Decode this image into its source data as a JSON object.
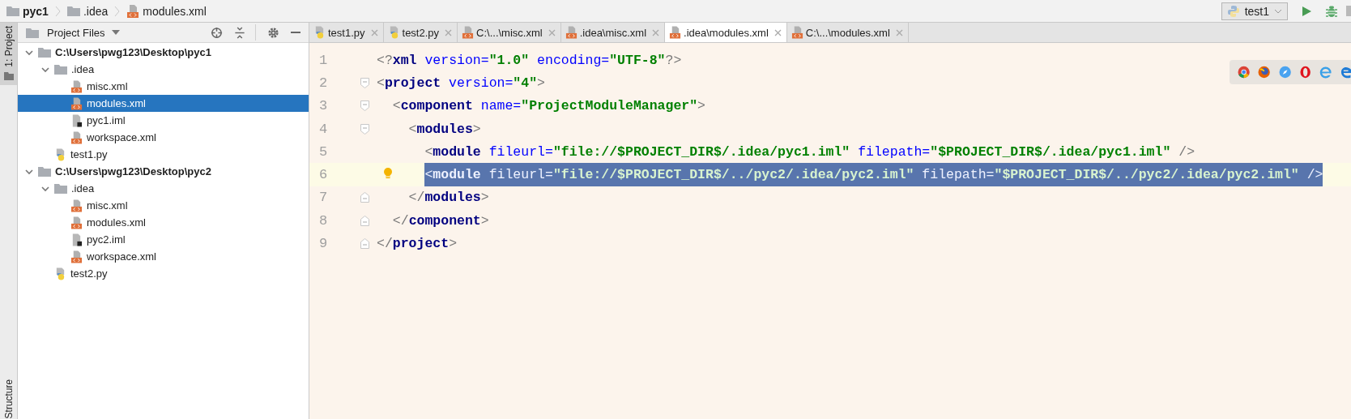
{
  "breadcrumbs": [
    {
      "kind": "folder",
      "label": "pyc1"
    },
    {
      "kind": "folder",
      "label": ".idea"
    },
    {
      "kind": "xml",
      "label": "modules.xml"
    }
  ],
  "run_config": {
    "label": "test1"
  },
  "left_tool_windows": [
    {
      "label": "1: Project",
      "selected": true
    }
  ],
  "bottom_tool_window": {
    "label": "Structure"
  },
  "project_panel": {
    "title": "Project Files",
    "tree": [
      {
        "kind": "folder",
        "label": "C:\\Users\\pwg123\\Desktop\\pyc1",
        "expanded": true,
        "selected": false,
        "children": [
          {
            "kind": "folder",
            "label": ".idea",
            "expanded": true,
            "selected": false,
            "children": [
              {
                "kind": "xml",
                "label": "misc.xml",
                "selected": false
              },
              {
                "kind": "xml",
                "label": "modules.xml",
                "selected": true
              },
              {
                "kind": "iml",
                "label": "pyc1.iml",
                "selected": false
              },
              {
                "kind": "xml",
                "label": "workspace.xml",
                "selected": false
              }
            ]
          },
          {
            "kind": "python",
            "label": "test1.py",
            "selected": false
          }
        ]
      },
      {
        "kind": "folder",
        "label": "C:\\Users\\pwg123\\Desktop\\pyc2",
        "expanded": true,
        "selected": false,
        "children": [
          {
            "kind": "folder",
            "label": ".idea",
            "expanded": true,
            "selected": false,
            "children": [
              {
                "kind": "xml",
                "label": "misc.xml",
                "selected": false
              },
              {
                "kind": "xml",
                "label": "modules.xml",
                "selected": false
              },
              {
                "kind": "iml",
                "label": "pyc2.iml",
                "selected": false
              },
              {
                "kind": "xml",
                "label": "workspace.xml",
                "selected": false
              }
            ]
          },
          {
            "kind": "python",
            "label": "test2.py",
            "selected": false
          }
        ]
      }
    ]
  },
  "tabs": [
    {
      "kind": "python",
      "label": "test1.py",
      "selected": false
    },
    {
      "kind": "python",
      "label": "test2.py",
      "selected": false
    },
    {
      "kind": "xml",
      "label": "C:\\...\\misc.xml",
      "selected": false
    },
    {
      "kind": "xml",
      "label": ".idea\\misc.xml",
      "selected": false
    },
    {
      "kind": "xml",
      "label": ".idea\\modules.xml",
      "selected": true
    },
    {
      "kind": "xml",
      "label": "C:\\...\\modules.xml",
      "selected": false
    }
  ],
  "editor": {
    "lines": [
      {
        "number": "1",
        "bulb": false,
        "selected": false,
        "tokens": [
          {
            "kind": "punct",
            "text": "<?"
          },
          {
            "kind": "name",
            "text": "xml"
          },
          {
            "kind": "attr",
            "text": " version="
          },
          {
            "kind": "value",
            "text": "\"1.0\""
          },
          {
            "kind": "attr",
            "text": " encoding="
          },
          {
            "kind": "value",
            "text": "\"UTF-8\""
          },
          {
            "kind": "punct",
            "text": "?>"
          }
        ]
      },
      {
        "number": "2",
        "fold": {
          "kind": "open"
        },
        "bulb": false,
        "selected": false,
        "tokens": [
          {
            "kind": "punct",
            "text": "<"
          },
          {
            "kind": "name",
            "text": "project"
          },
          {
            "kind": "attr",
            "text": " version="
          },
          {
            "kind": "value",
            "text": "\"4\""
          },
          {
            "kind": "punct",
            "text": ">"
          }
        ]
      },
      {
        "number": "3",
        "fold": {
          "kind": "open"
        },
        "bulb": false,
        "selected": false,
        "tokens": [
          {
            "kind": "punct",
            "text": "  <"
          },
          {
            "kind": "name",
            "text": "component"
          },
          {
            "kind": "attr",
            "text": " name="
          },
          {
            "kind": "value",
            "text": "\"ProjectModuleManager\""
          },
          {
            "kind": "punct",
            "text": ">"
          }
        ]
      },
      {
        "number": "4",
        "fold": {
          "kind": "open"
        },
        "bulb": false,
        "selected": false,
        "tokens": [
          {
            "kind": "punct",
            "text": "    <"
          },
          {
            "kind": "name",
            "text": "modules"
          },
          {
            "kind": "punct",
            "text": ">"
          }
        ]
      },
      {
        "number": "5",
        "bulb": false,
        "selected": false,
        "tokens": [
          {
            "kind": "punct",
            "text": "      <"
          },
          {
            "kind": "name",
            "text": "module"
          },
          {
            "kind": "attr",
            "text": " fileurl="
          },
          {
            "kind": "value",
            "text": "\"file://$PROJECT_DIR$/.idea/pyc1.iml\""
          },
          {
            "kind": "attr",
            "text": " filepath="
          },
          {
            "kind": "value",
            "text": "\"$PROJECT_DIR$/.idea/pyc1.iml\""
          },
          {
            "kind": "punct",
            "text": " />"
          }
        ]
      },
      {
        "number": "6",
        "bulb": true,
        "selected": true,
        "tokens": [
          {
            "kind": "punct",
            "text": "      <"
          },
          {
            "kind": "name",
            "text": "module"
          },
          {
            "kind": "attr",
            "text": " fileurl="
          },
          {
            "kind": "value",
            "text": "\"file://$PROJECT_DIR$/../pyc2/.idea/pyc2.iml\""
          },
          {
            "kind": "attr",
            "text": " filepath="
          },
          {
            "kind": "value",
            "text": "\"$PROJECT_DIR$/../pyc2/.idea/pyc2.iml\""
          },
          {
            "kind": "punct",
            "text": " />"
          }
        ]
      },
      {
        "number": "7",
        "fold": {
          "kind": "close"
        },
        "bulb": false,
        "selected": false,
        "tokens": [
          {
            "kind": "punct",
            "text": "    </"
          },
          {
            "kind": "name",
            "text": "modules"
          },
          {
            "kind": "punct",
            "text": ">"
          }
        ]
      },
      {
        "number": "8",
        "fold": {
          "kind": "close"
        },
        "bulb": false,
        "selected": false,
        "tokens": [
          {
            "kind": "punct",
            "text": "  </"
          },
          {
            "kind": "name",
            "text": "component"
          },
          {
            "kind": "punct",
            "text": ">"
          }
        ]
      },
      {
        "number": "9",
        "fold": {
          "kind": "close"
        },
        "bulb": false,
        "selected": false,
        "tokens": [
          {
            "kind": "punct",
            "text": "</"
          },
          {
            "kind": "name",
            "text": "project"
          },
          {
            "kind": "punct",
            "text": ">"
          }
        ]
      }
    ]
  }
}
